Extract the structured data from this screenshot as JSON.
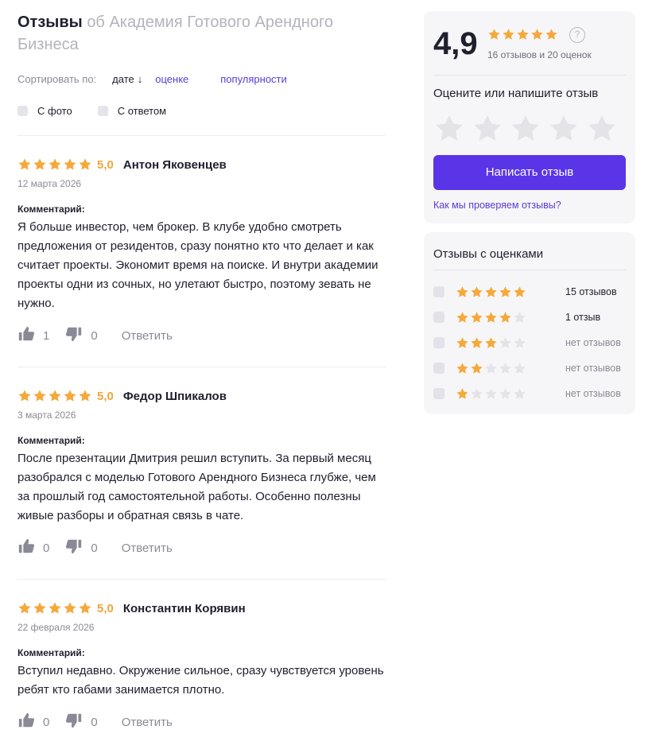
{
  "header": {
    "title": "Отзывы",
    "subtitle": "об Академия Готового Арендного Бизнеса"
  },
  "sort": {
    "label": "Сортировать по:",
    "options": [
      {
        "label": "дате",
        "active": true,
        "arrow": "↓"
      },
      {
        "label": "оценке",
        "active": false
      },
      {
        "label": "популярности",
        "active": false
      }
    ]
  },
  "filters": [
    {
      "label": "С фото",
      "checked": false
    },
    {
      "label": "С ответом",
      "checked": false
    }
  ],
  "reviews": [
    {
      "rating": 5,
      "score": "5,0",
      "author": "Антон Яковенцев",
      "date": "12 марта 2026",
      "comment_label": "Комментарий:",
      "text": "Я больше инвестор, чем брокер. В клубе удобно смотреть предложения от резидентов, сразу понятно кто что делает и как считает проекты. Экономит время на поиске. И внутри академии проекты одни из сочных, но улетают быстро, поэтому зевать не нужно.",
      "likes": "1",
      "dislikes": "0",
      "reply": "Ответить"
    },
    {
      "rating": 5,
      "score": "5,0",
      "author": "Федор Шпикалов",
      "date": "3 марта 2026",
      "comment_label": "Комментарий:",
      "text": "После презентации Дмитрия решил вступить. За первый месяц разобрался с моделью Готового Арендного Бизнеса глубже, чем за прошлый год самостоятельной работы. Особенно полезны живые разборы и обратная связь в чате.",
      "likes": "0",
      "dislikes": "0",
      "reply": "Ответить"
    },
    {
      "rating": 5,
      "score": "5,0",
      "author": "Константин Корявин",
      "date": "22 февраля 2026",
      "comment_label": "Комментарий:",
      "text": "Вступил недавно. Окружение сильное, сразу чувствуется уровень ребят кто габами занимается плотно.",
      "likes": "0",
      "dislikes": "0",
      "reply": "Ответить"
    }
  ],
  "summary": {
    "score": "4,9",
    "rating": 5,
    "counts": "16 отзывов и 20 оценок",
    "help": "?",
    "rate_title": "Оцените или напишите отзыв",
    "write_button": "Написать отзыв",
    "check_link": "Как мы проверяем отзывы?"
  },
  "distribution": {
    "title": "Отзывы с оценками",
    "rows": [
      {
        "stars": 5,
        "count": "15 отзывов"
      },
      {
        "stars": 4,
        "count": "1 отзыв"
      },
      {
        "stars": 3,
        "count": "нет отзывов"
      },
      {
        "stars": 2,
        "count": "нет отзывов"
      },
      {
        "stars": 1,
        "count": "нет отзывов"
      }
    ]
  },
  "colors": {
    "star_filled": "#f5a93b",
    "star_empty": "#e3e3e8",
    "accent": "#5a35e8",
    "link": "#5a3bd6"
  }
}
